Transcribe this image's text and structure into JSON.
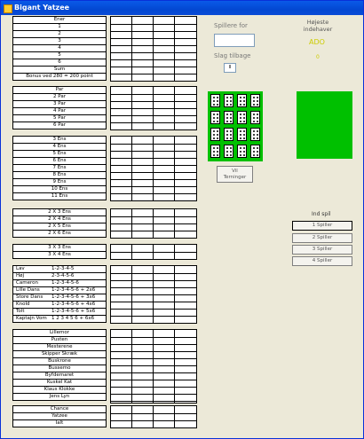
{
  "window": {
    "title": "Bigant Yatzee"
  },
  "left": {
    "upper": [
      "Ener",
      "1",
      "2",
      "3",
      "4",
      "5",
      "6",
      "Sum",
      "Bonus ved 280 = 200 point"
    ],
    "pairs": [
      "Par",
      "2 Par",
      "3 Par",
      "4 Par",
      "5 Par",
      "6 Par"
    ],
    "kinds": [
      "3 Ens",
      "4 Ens",
      "5 Ens",
      "6 Ens",
      "7 Ens",
      "8 Ens",
      "9 Ens",
      "10 Ens",
      "11 Ens"
    ],
    "multi": [
      "2 X 3 Ens",
      "2 X 4 Ens",
      "2 X 5 Ens",
      "2 X 6 Ens"
    ],
    "three": [
      "3 X 3 Ens",
      "3 X 4 Ens"
    ],
    "straights": [
      {
        "name": "Lav",
        "value": "1-2-3-4-5"
      },
      {
        "name": "Høj",
        "value": "2-3-4-5-6"
      },
      {
        "name": "Cameron",
        "value": "1-2-3-4-5-6"
      },
      {
        "name": "Lille Dans",
        "value": "1-2-3-4-5-6 + 2x6"
      },
      {
        "name": "Store Dans",
        "value": "1-2-3-4-5-6 + 3x6"
      },
      {
        "name": "Knold",
        "value": "1-2-3-4-5-6 + 4x6"
      },
      {
        "name": "Tolt",
        "value": "1-2-3-4-5-6 + 5x6"
      },
      {
        "name": "Kaptajn Vom",
        "value": "1 2 3 4 5 6 + 6x6"
      }
    ],
    "specials": [
      "Lillemor",
      "Pusten",
      "Mesterene",
      "Skipper Skræk",
      "Buskrone",
      "Bussemo",
      "Byfdemaret",
      "Kuskel Kat",
      "Klaus Klokke",
      "Jens Lyn"
    ],
    "bottom": [
      "Chance",
      "Yatzee",
      "Ialt"
    ]
  },
  "middle": {
    "players_label": "Spillere for",
    "throw_label": "Slag tilbage",
    "throw_value": "II",
    "roll_button": "Vil\nTerninger"
  },
  "right": {
    "winner_label": "Højeste\nindehaver",
    "winner_name": "ADO",
    "winner_score": "0",
    "players_header": "Ind spil",
    "player_buttons": [
      "1 Spiller",
      "2 Spiller",
      "3 Spiller",
      "4 Spiller"
    ]
  },
  "colors": {
    "felt": "#00c000",
    "accent": "#cccc00",
    "titlebar": "#0348d2"
  }
}
